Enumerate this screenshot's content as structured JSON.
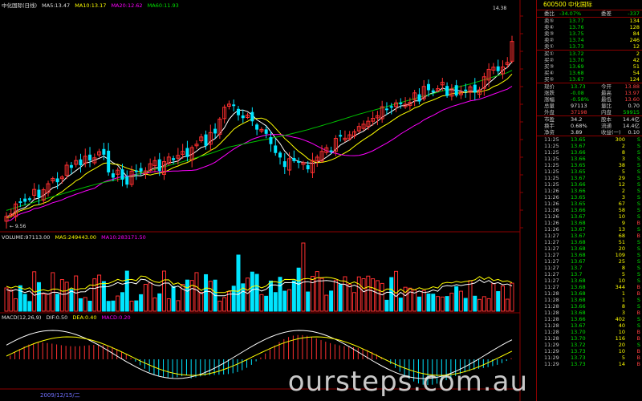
{
  "chart_header": {
    "name": "中化国际(日线)",
    "ma5": "MA5:13.47",
    "ma10": "MA10:13.17",
    "ma20": "MA20:12.62",
    "ma60": "MA60:11.93"
  },
  "price_marks": {
    "high": "14.38",
    "low": "9.56"
  },
  "volume_header": {
    "title": "VOLUME:97113.00",
    "ma5": "MA5:249443.00",
    "ma10": "MA10:283171.50"
  },
  "macd_header": {
    "title": "MACD(12,26,9)",
    "dif": "DIF:0.50",
    "dea": "DEA:0.40",
    "macd": "MACD:0.20"
  },
  "date_label": "2009/12/15/二",
  "watermark": "oursteps.com.au",
  "side_panel": {
    "code": "600500",
    "name": "中化国际",
    "weibi": {
      "label": "委比",
      "value": "-34.07%",
      "label2": "委差",
      "value2": "-337"
    },
    "sells": [
      {
        "label": "卖⑤",
        "price": "13.77",
        "vol": "134"
      },
      {
        "label": "卖④",
        "price": "13.76",
        "vol": "128"
      },
      {
        "label": "卖③",
        "price": "13.75",
        "vol": "84"
      },
      {
        "label": "卖②",
        "price": "13.74",
        "vol": "246"
      },
      {
        "label": "卖①",
        "price": "13.73",
        "vol": "12"
      }
    ],
    "buys": [
      {
        "label": "买①",
        "price": "13.72",
        "vol": "2"
      },
      {
        "label": "买②",
        "price": "13.70",
        "vol": "42"
      },
      {
        "label": "买③",
        "price": "13.69",
        "vol": "51"
      },
      {
        "label": "买④",
        "price": "13.68",
        "vol": "54"
      },
      {
        "label": "买⑤",
        "price": "13.67",
        "vol": "124"
      }
    ],
    "quote": [
      {
        "l1": "现价",
        "v1": "13.73",
        "l2": "今开",
        "v2": "13.88"
      },
      {
        "l1": "涨跌",
        "v1": "-0.08",
        "l2": "最高",
        "v2": "13.97"
      },
      {
        "l1": "涨幅",
        "v1": "-0.58%",
        "l2": "最低",
        "v2": "13.60"
      },
      {
        "l1": "总量",
        "v1": "97113",
        "l2": "量比",
        "v2": "0.70"
      },
      {
        "l1": "外盘",
        "v1": "37198",
        "l2": "内盘",
        "v2": "59915"
      }
    ],
    "fin": [
      {
        "l1": "市盈",
        "v1": "34.2",
        "l2": "股本",
        "v2": "14.4亿"
      },
      {
        "l1": "换手",
        "v1": "0.68%",
        "l2": "流通",
        "v2": "14.4亿"
      },
      {
        "l1": "净资",
        "v1": "3.89",
        "l2": "收益(一)",
        "v2": "0.10"
      }
    ],
    "ticks": [
      [
        "11:25",
        "13.65",
        "300",
        "S"
      ],
      [
        "11:25",
        "13.67",
        "2",
        "S"
      ],
      [
        "11:25",
        "13.66",
        "8",
        "S"
      ],
      [
        "11:25",
        "13.66",
        "3",
        "S"
      ],
      [
        "11:25",
        "13.65",
        "38",
        "S"
      ],
      [
        "11:25",
        "13.65",
        "5",
        "S"
      ],
      [
        "11:25",
        "13.67",
        "29",
        "S"
      ],
      [
        "11:25",
        "13.66",
        "12",
        "S"
      ],
      [
        "11:26",
        "13.66",
        "2",
        "S"
      ],
      [
        "11:26",
        "13.65",
        "3",
        "S"
      ],
      [
        "11:26",
        "13.65",
        "67",
        "S"
      ],
      [
        "11:26",
        "13.66",
        "58",
        "S"
      ],
      [
        "11:26",
        "13.67",
        "10",
        "S"
      ],
      [
        "11:26",
        "13.68",
        "9",
        "B"
      ],
      [
        "11:26",
        "13.67",
        "13",
        "S"
      ],
      [
        "11:27",
        "13.67",
        "68",
        "B"
      ],
      [
        "11:27",
        "13.68",
        "51",
        "S"
      ],
      [
        "11:27",
        "13.68",
        "20",
        "S"
      ],
      [
        "11:27",
        "13.68",
        "109",
        "S"
      ],
      [
        "11:27",
        "13.67",
        "25",
        "S"
      ],
      [
        "11:27",
        "13.7",
        "8",
        "S"
      ],
      [
        "11:27",
        "13.7",
        "5",
        "S"
      ],
      [
        "11:27",
        "13.68",
        "10",
        "S"
      ],
      [
        "11:27",
        "13.68",
        "344",
        "B"
      ],
      [
        "11:28",
        "13.68",
        "1",
        "B"
      ],
      [
        "11:28",
        "13.68",
        "1",
        "S"
      ],
      [
        "11:28",
        "13.66",
        "8",
        "S"
      ],
      [
        "11:28",
        "13.68",
        "3",
        "B"
      ],
      [
        "11:28",
        "13.66",
        "402",
        "S"
      ],
      [
        "11:28",
        "13.67",
        "40",
        "S"
      ],
      [
        "11:28",
        "13.70",
        "10",
        "B"
      ],
      [
        "11:28",
        "13.70",
        "116",
        "B"
      ],
      [
        "11:29",
        "13.72",
        "20",
        "S"
      ],
      [
        "11:29",
        "13.73",
        "10",
        "B"
      ],
      [
        "11:29",
        "13.73",
        "5",
        "B"
      ],
      [
        "11:29",
        "13.73",
        "14",
        "B"
      ]
    ]
  },
  "colors": {
    "up": "#ff3030",
    "down": "#00e5ff",
    "ma5": "#ffffff",
    "ma10": "#ffff00",
    "ma20": "#ff00ff",
    "ma60": "#00c000",
    "grid": "#8b0000"
  }
}
